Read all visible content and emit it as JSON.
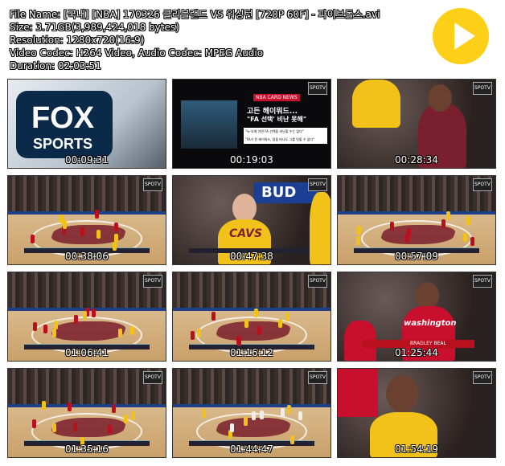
{
  "info": {
    "lines": [
      "File Name: [국내] [NBA] 170326 클리블랜드 VS 워싱턴 [720P 60F] - 파이브돌스.avi",
      "Size: 3.71GB(3,989,424,018 bytes)",
      "Resolution: 1280x720(16:9)",
      "Video Codec: H264 Video, Audio Codec: MPEG Audio",
      "Duration: 02:03:51"
    ]
  },
  "play_button": {
    "color": "#fdd017",
    "icon": "play-icon"
  },
  "thumbnails": [
    {
      "time": "00:09:31",
      "scene": "fox"
    },
    {
      "time": "00:19:03",
      "scene": "news",
      "news_header": "NBA CARD NEWS",
      "news_title_1": "고든 헤이워드...",
      "news_title_2": "\"FA 선택' 비난 못해\"",
      "news_body_1": "\"뉴-오에 가면 FA 선택을 비난할 수는 없다\"",
      "news_body_2": "\"FA가 된 헤이워드, 팀을 떠나도 그를 탓할 수 없다\""
    },
    {
      "time": "00:28:34",
      "scene": "closeup"
    },
    {
      "time": "00:38:06",
      "scene": "court"
    },
    {
      "time": "00:47:38",
      "scene": "love",
      "ad_text": "BUD",
      "jersey_text": "CAVS"
    },
    {
      "time": "00:57:09",
      "scene": "court"
    },
    {
      "time": "01:06:41",
      "scene": "court"
    },
    {
      "time": "01:16:12",
      "scene": "court"
    },
    {
      "time": "01:25:44",
      "scene": "wizards",
      "jersey_text": "washington",
      "graphic_text": "BRADLEY BEAL"
    },
    {
      "time": "01:35:16",
      "scene": "court2"
    },
    {
      "time": "01:44:47",
      "scene": "court3"
    },
    {
      "time": "01:54:19",
      "scene": "lebron"
    }
  ],
  "colors": {
    "cavs_wine": "#7a1f2e",
    "cavs_gold": "#f2c21a",
    "wizards_red": "#b8101c"
  },
  "logo_text": "SPOTV"
}
